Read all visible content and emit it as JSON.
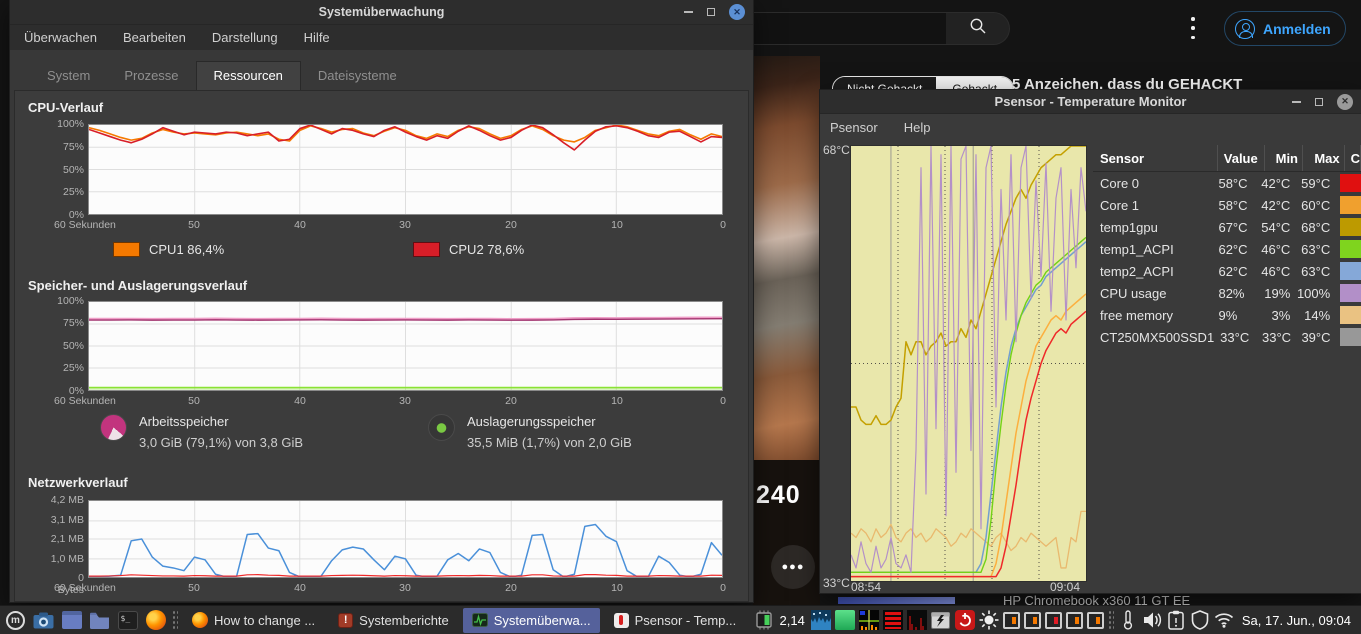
{
  "youtube": {
    "signin_label": "Anmelden",
    "chip_dark": "Nicht Gehackt",
    "chip_light": "Gehackt",
    "video_title": "5 Anzeichen, dass du GEHACKT",
    "resolution_badge": "240",
    "more_glyph": "●●●",
    "caption": "HP Chromebook x360 11 GT EE"
  },
  "system_monitor": {
    "title": "Systemüberwachung",
    "menu": [
      "Überwachen",
      "Bearbeiten",
      "Darstellung",
      "Hilfe"
    ],
    "tabs": [
      "System",
      "Prozesse",
      "Ressourcen",
      "Dateisysteme"
    ],
    "active_tab": "Ressourcen",
    "cpu": {
      "title": "CPU-Verlauf",
      "y_labels": [
        "100%",
        "75%",
        "50%",
        "25%",
        "0%"
      ],
      "x_labels": [
        "60 Sekunden",
        "50",
        "40",
        "30",
        "20",
        "10",
        "0"
      ],
      "legend": [
        {
          "label": "CPU1  86,4%",
          "color": "#f57900"
        },
        {
          "label": "CPU2  78,6%",
          "color": "#d81e28"
        }
      ]
    },
    "memory": {
      "title": "Speicher- und Auslagerungsverlauf",
      "y_labels": [
        "100%",
        "75%",
        "50%",
        "25%",
        "0%"
      ],
      "x_labels": [
        "60 Sekunden",
        "50",
        "40",
        "30",
        "20",
        "10",
        "0"
      ],
      "legend": [
        {
          "title": "Arbeitsspeicher",
          "value": "3,0 GiB (79,1%) von 3,8 GiB"
        },
        {
          "title": "Auslagerungsspeicher",
          "value": "35,5 MiB (1,7%) von 2,0 GiB"
        }
      ]
    },
    "network": {
      "title": "Netzwerkverlauf",
      "y_labels": [
        "4,2 MB",
        "3,1 MB",
        "2,1 MB",
        "1,0 MB",
        "0 Bytes"
      ],
      "x_labels": [
        "60 Sekunden",
        "50",
        "40",
        "30",
        "20",
        "10",
        "0"
      ]
    }
  },
  "psensor": {
    "title": "Psensor - Temperature Monitor",
    "menu": [
      "Psensor",
      "Help"
    ],
    "axis": {
      "top": "68°C",
      "bottom": "33°C",
      "t_start": "08:54",
      "t_end": "09:04"
    },
    "table": {
      "headers": [
        "Sensor",
        "Value",
        "Min",
        "Max",
        "C"
      ],
      "rows": [
        {
          "sensor": "Core 0",
          "value": "58°C",
          "min": "42°C",
          "max": "59°C",
          "color": "#e01010"
        },
        {
          "sensor": "Core 1",
          "value": "58°C",
          "min": "42°C",
          "max": "60°C",
          "color": "#f0a02e"
        },
        {
          "sensor": "temp1gpu",
          "value": "67°C",
          "min": "54°C",
          "max": "68°C",
          "color": "#bd9a00"
        },
        {
          "sensor": "temp1_ACPI",
          "value": "62°C",
          "min": "46°C",
          "max": "63°C",
          "color": "#7fd41e"
        },
        {
          "sensor": "temp2_ACPI",
          "value": "62°C",
          "min": "46°C",
          "max": "63°C",
          "color": "#85a8d8"
        },
        {
          "sensor": "CPU usage",
          "value": "82%",
          "min": "19%",
          "max": "100%",
          "color": "#b28fc8"
        },
        {
          "sensor": "free memory",
          "value": "9%",
          "min": "3%",
          "max": "14%",
          "color": "#eac282"
        },
        {
          "sensor": "CT250MX500SSD1",
          "value": "33°C",
          "min": "33°C",
          "max": "39°C",
          "color": "#989898"
        }
      ]
    }
  },
  "taskbar": {
    "windows": [
      {
        "label": "How to change ...",
        "icon": "firefox"
      },
      {
        "label": "Systemberichte",
        "icon": "alert"
      },
      {
        "label": "Systemüberwa...",
        "icon": "monitor",
        "active": true
      },
      {
        "label": "Psensor - Temp...",
        "icon": "thermometer"
      }
    ],
    "load_average": "2,14",
    "clock": "Sa, 17. Jun., 09:04"
  },
  "chart_data": [
    {
      "id": "cpu-history",
      "type": "line",
      "ylim": [
        0,
        100
      ],
      "grid": {
        "v": [
          16.7,
          33.3,
          50,
          66.7,
          83.3
        ],
        "h": [
          25,
          50,
          75
        ],
        "color": "#dedede"
      },
      "x_axis": "seconds 60..0",
      "series": [
        {
          "name": "CPU1",
          "color": "#f57900",
          "width": 1.6,
          "values": [
            97,
            94,
            90,
            86,
            83,
            85,
            91,
            95,
            92,
            90,
            91,
            90,
            89,
            91,
            92,
            90,
            88,
            90,
            84,
            82,
            94,
            99,
            96,
            92,
            95,
            96,
            91,
            88,
            93,
            97,
            94,
            88,
            85,
            90,
            87,
            94,
            98,
            96,
            90,
            85,
            88,
            95,
            99,
            95,
            88,
            83,
            81,
            86,
            94,
            97,
            100,
            98,
            94,
            90,
            88,
            93,
            95,
            89,
            84,
            90,
            87
          ]
        },
        {
          "name": "CPU2",
          "color": "#d81e28",
          "width": 1.6,
          "values": [
            95,
            91,
            87,
            83,
            80,
            84,
            90,
            97,
            93,
            89,
            92,
            91,
            90,
            92,
            91,
            88,
            90,
            92,
            82,
            84,
            96,
            100,
            95,
            90,
            96,
            94,
            90,
            87,
            94,
            98,
            92,
            87,
            83,
            88,
            85,
            93,
            99,
            94,
            88,
            83,
            86,
            94,
            100,
            97,
            89,
            80,
            72,
            83,
            93,
            98,
            99,
            97,
            93,
            88,
            86,
            92,
            93,
            87,
            81,
            87,
            86
          ]
        }
      ]
    },
    {
      "id": "memory-history",
      "type": "line",
      "ylim": [
        0,
        100
      ],
      "grid": {
        "v": [
          16.7,
          33.3,
          50,
          66.7,
          83.3
        ],
        "h": [
          25,
          50,
          75
        ],
        "color": "#dedede"
      },
      "series": [
        {
          "name": "memory-halo",
          "color": "#ef9ec7",
          "width": 2.4,
          "values": [
            80.7,
            80.7,
            80.8,
            80.6,
            80.7,
            80.7,
            81.0,
            80.7,
            80.6,
            80.7,
            80.8,
            81.0,
            80.7,
            80.6,
            80.7,
            80.8,
            80.7,
            80.6,
            80.8,
            80.7,
            80.5,
            80.6,
            80.8,
            81.4,
            81.6,
            81.5,
            81.7,
            81.8,
            82.0,
            82.1,
            82.2
          ]
        },
        {
          "name": "memory",
          "color": "#a1336e",
          "width": 1.4,
          "values": [
            79.5,
            79.5,
            79.6,
            79.4,
            79.5,
            79.5,
            79.8,
            79.5,
            79.4,
            79.5,
            79.6,
            79.8,
            79.5,
            79.4,
            79.5,
            79.6,
            79.5,
            79.4,
            79.6,
            79.5,
            79.3,
            79.4,
            79.6,
            80.2,
            80.4,
            80.3,
            80.5,
            80.6,
            80.8,
            80.9,
            81.0
          ]
        },
        {
          "name": "swap",
          "color": "#8ae234",
          "width": 1.6,
          "fill": "rgba(138,226,52,0.30)",
          "values": [
            2.8,
            2.8,
            2.8,
            2.8,
            2.8,
            2.8,
            2.8,
            2.8,
            2.8,
            2.8,
            2.8,
            2.8,
            2.8,
            2.8,
            2.8,
            2.8,
            2.8,
            2.8,
            2.8,
            2.8,
            2.8,
            2.8,
            2.8,
            2.8,
            2.8,
            2.8,
            2.8,
            2.8,
            2.8,
            2.8,
            2.8
          ]
        }
      ]
    },
    {
      "id": "network-history",
      "type": "line",
      "ylim": [
        0,
        4.2
      ],
      "grid": {
        "v": [
          16.7,
          33.3,
          50,
          66.7,
          83.3
        ],
        "h": [
          23.8,
          50,
          73.8
        ],
        "color": "#dedede"
      },
      "series": [
        {
          "name": "receiving",
          "color": "#4a90d9",
          "width": 1.5,
          "values": [
            0,
            0,
            0.05,
            0.1,
            2.0,
            2.1,
            1.1,
            0.6,
            0.5,
            0.35,
            1.1,
            0.95,
            0.15,
            0,
            0.05,
            2.35,
            2.4,
            1.6,
            1.45,
            0.25,
            0,
            0,
            0.05,
            0.9,
            1.5,
            1.65,
            1.55,
            0.95,
            0.4,
            1.15,
            1.0,
            0.1,
            0,
            0.05,
            0.95,
            1.3,
            0.9,
            1.55,
            1.35,
            0.25,
            0,
            0.1,
            2.3,
            2.35,
            0.4,
            0,
            0.15,
            2.8,
            2.9,
            2.25,
            1.95,
            0.35,
            0,
            0,
            1.15,
            0.8,
            0.1,
            0,
            0.15,
            1.9,
            1.2
          ]
        },
        {
          "name": "sending",
          "color": "#ef2929",
          "width": 1.2,
          "values": [
            0.05,
            0.05,
            0.06,
            0.08,
            0.12,
            0.1,
            0.08,
            0.06,
            0.06,
            0.05,
            0.08,
            0.07,
            0.05,
            0.05,
            0.05,
            0.12,
            0.13,
            0.1,
            0.09,
            0.05,
            0.05,
            0.05,
            0.05,
            0.08,
            0.09,
            0.1,
            0.09,
            0.07,
            0.05,
            0.08,
            0.07,
            0.05,
            0.05,
            0.05,
            0.07,
            0.08,
            0.07,
            0.09,
            0.08,
            0.05,
            0.05,
            0.05,
            0.12,
            0.12,
            0.06,
            0.05,
            0.05,
            0.13,
            0.13,
            0.1,
            0.09,
            0.05,
            0.05,
            0.05,
            0.08,
            0.07,
            0.05,
            0.05,
            0.05,
            0.1,
            0.09
          ]
        }
      ]
    },
    {
      "id": "psensor-graph",
      "type": "line",
      "ylim": [
        0,
        100
      ],
      "x_range": [
        "08:54",
        "09:04"
      ],
      "y_range": [
        "33°C",
        "68°C"
      ],
      "grid": {
        "v": [
          20,
          40,
          60,
          80
        ],
        "h": [
          50
        ],
        "color": "#55524a",
        "dash": "1,3"
      },
      "vlines": [
        {
          "x": 17,
          "color": "#9a9a92"
        },
        {
          "x": 52,
          "color": "#9a9a92"
        }
      ],
      "series": [
        {
          "name": "free memory",
          "color": "#e9b96e",
          "width": 1.3,
          "values": [
            11,
            10,
            12,
            11,
            9,
            12,
            10,
            11,
            13,
            10,
            9,
            11,
            12,
            10,
            11,
            9,
            10,
            12,
            11,
            10,
            8,
            9,
            11,
            10,
            12,
            11,
            10,
            9,
            8,
            10,
            11,
            9,
            7,
            8,
            10,
            9,
            11,
            10,
            9,
            8,
            9,
            10,
            3,
            3,
            10,
            9,
            16,
            16
          ]
        },
        {
          "name": "temp1gpu",
          "color": "#c4a000",
          "width": 1.5,
          "values": [
            40,
            40,
            37,
            36,
            36,
            38,
            36,
            36,
            37,
            40,
            42,
            55,
            52,
            55,
            55,
            52,
            54,
            55,
            57,
            54,
            55,
            55,
            58,
            56,
            60,
            58,
            62,
            66,
            70,
            74,
            78,
            82,
            85,
            88,
            90,
            88,
            91,
            93,
            95,
            96,
            97,
            98,
            98,
            99,
            100,
            100,
            100,
            100
          ]
        },
        {
          "name": "temp2_ACPI",
          "color": "#729fcf",
          "width": 1.5,
          "values": [
            2,
            2,
            2,
            2,
            2,
            2,
            2,
            2,
            2,
            2,
            2,
            2,
            2,
            2,
            2,
            2,
            2,
            2,
            2,
            2,
            2,
            2,
            2,
            2,
            2,
            2,
            4,
            10,
            20,
            30,
            40,
            48,
            54,
            58,
            61,
            63,
            65,
            67,
            68,
            70,
            71,
            72,
            73,
            74,
            75,
            76,
            77,
            78
          ]
        },
        {
          "name": "temp1_ACPI",
          "color": "#73d216",
          "width": 1.4,
          "values": [
            2,
            2,
            2,
            2,
            2,
            2,
            2,
            2,
            2,
            2,
            2,
            2,
            2,
            2,
            2,
            2,
            2,
            2,
            2,
            2,
            2,
            2,
            2,
            2,
            2,
            2,
            2,
            5,
            14,
            26,
            36,
            45,
            52,
            57,
            61,
            64,
            66,
            68,
            69,
            71,
            72,
            73,
            74,
            75,
            76,
            77,
            78,
            79
          ]
        },
        {
          "name": "Core 1",
          "color": "#fcaf3e",
          "width": 1.5,
          "values": [
            1,
            1,
            1,
            1,
            1,
            1,
            1,
            1,
            1,
            1,
            1,
            1,
            1,
            1,
            1,
            1,
            1,
            1,
            1,
            1,
            1,
            1,
            1,
            1,
            1,
            1,
            1,
            1,
            1,
            4,
            10,
            18,
            26,
            34,
            40,
            46,
            50,
            54,
            56,
            58,
            60,
            61,
            60,
            62,
            63,
            64,
            65,
            66
          ]
        },
        {
          "name": "Core 0",
          "color": "#ef2929",
          "width": 1.5,
          "values": [
            1,
            1,
            1,
            1,
            1,
            1,
            1,
            1,
            1,
            1,
            1,
            1,
            1,
            1,
            1,
            1,
            1,
            1,
            1,
            1,
            1,
            1,
            1,
            1,
            1,
            1,
            1,
            1,
            1,
            1,
            3,
            8,
            15,
            22,
            30,
            37,
            42,
            46,
            50,
            53,
            55,
            57,
            58,
            57,
            59,
            60,
            61,
            62
          ]
        },
        {
          "name": "CPU usage",
          "color": "#b491c8",
          "width": 1.2,
          "values": [
            6,
            3,
            9,
            4,
            2,
            8,
            3,
            5,
            10,
            4,
            3,
            6,
            2,
            30,
            95,
            20,
            100,
            35,
            98,
            15,
            100,
            25,
            97,
            100,
            30,
            98,
            12,
            95,
            100,
            40,
            90,
            60,
            98,
            55,
            95,
            100,
            65,
            92,
            70,
            96,
            62,
            88,
            95,
            60,
            90,
            72,
            95,
            85
          ]
        }
      ]
    }
  ]
}
